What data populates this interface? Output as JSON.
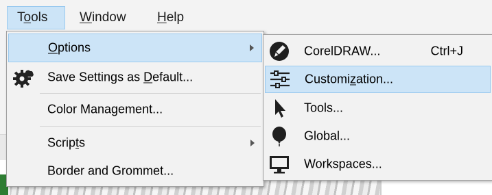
{
  "menubar": {
    "items": [
      {
        "pre": "T",
        "mn": "o",
        "post": "ols"
      },
      {
        "pre": "",
        "mn": "W",
        "post": "indow"
      },
      {
        "pre": "",
        "mn": "H",
        "post": "elp"
      }
    ]
  },
  "tools_menu": {
    "items": [
      {
        "pre": "",
        "mn": "O",
        "post": "ptions"
      },
      {
        "pre": "Save Settings as ",
        "mn": "D",
        "post": "efault..."
      },
      {
        "pre": "Color Management...",
        "mn": "",
        "post": ""
      },
      {
        "pre": "Scrip",
        "mn": "t",
        "post": "s"
      },
      {
        "pre": "Border and Grommet...",
        "mn": "",
        "post": ""
      }
    ]
  },
  "options_submenu": {
    "items": [
      {
        "label": "CorelDRAW...",
        "shortcut": "Ctrl+J",
        "icon": "coreldraw-icon"
      },
      {
        "pre": "Customi",
        "mn": "z",
        "post": "ation...",
        "icon": "sliders-icon"
      },
      {
        "label": "Tools...",
        "icon": "pointer-icon"
      },
      {
        "label": "Global...",
        "icon": "balloon-icon"
      },
      {
        "label": "Workspaces...",
        "icon": "monitor-icon"
      }
    ]
  },
  "colors": {
    "highlight": "#cce4f7",
    "highlight_border": "#99c9ef",
    "menu_bg": "#f2f2f2"
  }
}
